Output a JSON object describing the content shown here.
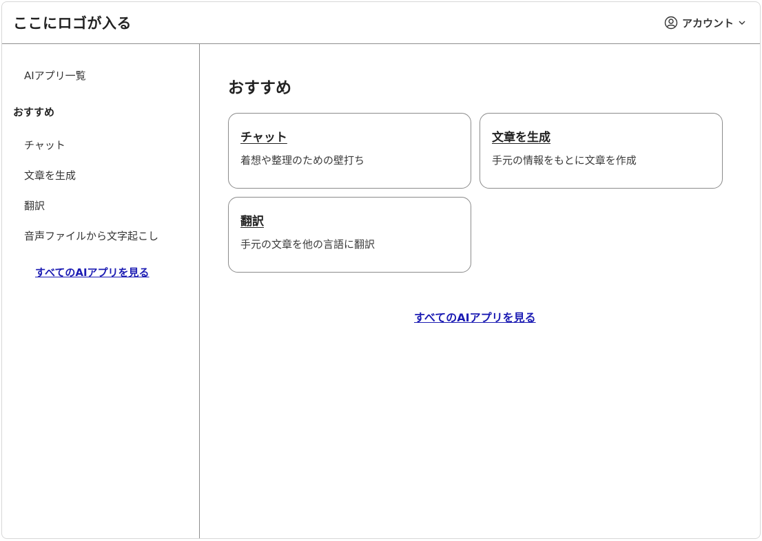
{
  "header": {
    "logo": "ここにロゴが入る",
    "account_label": "アカウント",
    "account_icon": "user-circle-icon",
    "chevron_icon": "chevron-down-icon"
  },
  "sidebar": {
    "app_list_link": "AIアプリ一覧",
    "section_heading": "おすすめ",
    "items": [
      {
        "label": "チャット"
      },
      {
        "label": "文章を生成"
      },
      {
        "label": "翻訳"
      },
      {
        "label": "音声ファイルから文字起こし"
      }
    ],
    "all_apps_link": "すべてのAIアプリを見る"
  },
  "main": {
    "title": "おすすめ",
    "cards": [
      {
        "title": "チャット",
        "description": "着想や整理のための壁打ち"
      },
      {
        "title": "文章を生成",
        "description": "手元の情報をもとに文章を作成"
      },
      {
        "title": "翻訳",
        "description": "手元の文章を他の言語に翻訳"
      }
    ],
    "all_apps_link": "すべてのAIアプリを見る"
  },
  "colors": {
    "link": "#1b1bb3",
    "border": "#8d8d8d",
    "text": "#2b2b2b"
  }
}
